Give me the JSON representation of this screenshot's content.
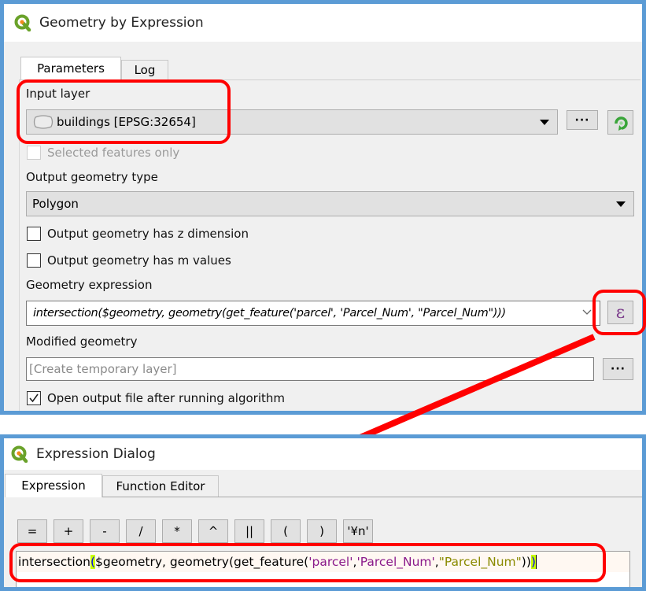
{
  "dialog1": {
    "title": "Geometry by Expression",
    "tabs": [
      {
        "label": "Parameters",
        "active": true
      },
      {
        "label": "Log",
        "active": false
      }
    ],
    "input_layer": {
      "label": "Input layer",
      "value": "buildings [EPSG:32654]",
      "icon": "polygon-layer-icon",
      "browse_label": "···",
      "iterate_icon": "iterate-icon"
    },
    "selected_only": {
      "label": "Selected features only",
      "checked": false,
      "enabled": false
    },
    "output_geometry_type": {
      "label": "Output geometry type",
      "value": "Polygon"
    },
    "has_z": {
      "label": "Output geometry has z dimension",
      "checked": false
    },
    "has_m": {
      "label": "Output geometry has m values",
      "checked": false
    },
    "geometry_expression": {
      "label": "Geometry expression",
      "value": "intersection($geometry, geometry(get_feature('parcel', 'Parcel_Num', \"Parcel_Num\")))",
      "expression_button_glyph": "ε"
    },
    "modified_geometry": {
      "label": "Modified geometry",
      "placeholder": "[Create temporary layer]",
      "browse_label": "···"
    },
    "open_output": {
      "label": "Open output file after running algorithm",
      "checked": true
    }
  },
  "dialog2": {
    "title": "Expression Dialog",
    "tabs": [
      {
        "label": "Expression",
        "active": true
      },
      {
        "label": "Function Editor",
        "active": false
      }
    ],
    "operators": [
      "=",
      "+",
      "-",
      "/",
      "*",
      "^",
      "||",
      "(",
      ")",
      "'¥n'"
    ],
    "expression": {
      "func": "intersection",
      "open_paren": "(",
      "part1": "$geometry, geometry(get_feature(",
      "str1": "'parcel'",
      "sep1": ", ",
      "str2": "'Parcel_Num'",
      "sep2": ", ",
      "field": "\"Parcel_Num\"",
      "close1": "))",
      "close_last": ")"
    }
  },
  "annotations": {
    "highlight_color": "#ff0000",
    "frame_color": "#5b9bd5"
  }
}
